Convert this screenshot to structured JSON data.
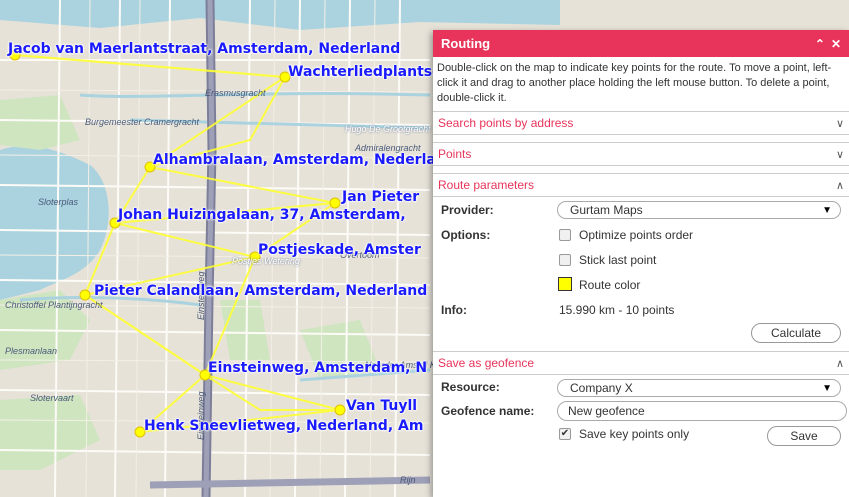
{
  "map": {
    "labels": [
      "Jacob van Maerlantstraat, Amsterdam, Nederland",
      "Wachterliedplantsoen",
      "Alhambralaan, Amsterdam, Nederland",
      "Jan Pieter",
      "Johan Huizingalaan, 37, Amsterdam,",
      "Postjeskade, Amster",
      "Pieter Calandlaan, Amsterdam, Nederland",
      "Einsteinweg, Amsterdam, N",
      "Van Tuyll",
      "Henk Sneevlietweg, Nederland, Am"
    ],
    "streets": [
      "Erasmusgracht",
      "Burgemeester Cramergracht",
      "Hugo De Grootgracht",
      "Admiralengracht",
      "Sloterplas",
      "Christoffel Plantijngracht",
      "Plesmanlaan",
      "Slotervaart",
      "Noorder Amstel Kanaal",
      "Postjes Wetering",
      "Overtoom",
      "Einsteinweg",
      "Einsteinweg",
      "Rijn"
    ],
    "route_color": "#ffff33",
    "label_color": "#1a1aff"
  },
  "panel": {
    "title": "Routing",
    "accent": "#e8345a",
    "description": "Double-click on the map to indicate key points for the route. To move a point, left-click it and drag to another place holding the left mouse button. To delete a point, double-click it.",
    "sections": {
      "search": "Search points by address",
      "points": "Points",
      "route_params": "Route parameters",
      "geofence": "Save as geofence"
    },
    "route": {
      "provider_label": "Provider:",
      "provider_value": "Gurtam Maps",
      "options_label": "Options:",
      "opt_optimize": "Optimize points order",
      "opt_stick": "Stick last point",
      "opt_color": "Route color",
      "info_label": "Info:",
      "info_value": "15.990 km - 10 points",
      "calculate": "Calculate"
    },
    "geofence": {
      "resource_label": "Resource:",
      "resource_value": "Company X",
      "name_label": "Geofence name:",
      "name_value": "New geofence",
      "keypoints_label": "Save key points only",
      "save": "Save"
    }
  }
}
